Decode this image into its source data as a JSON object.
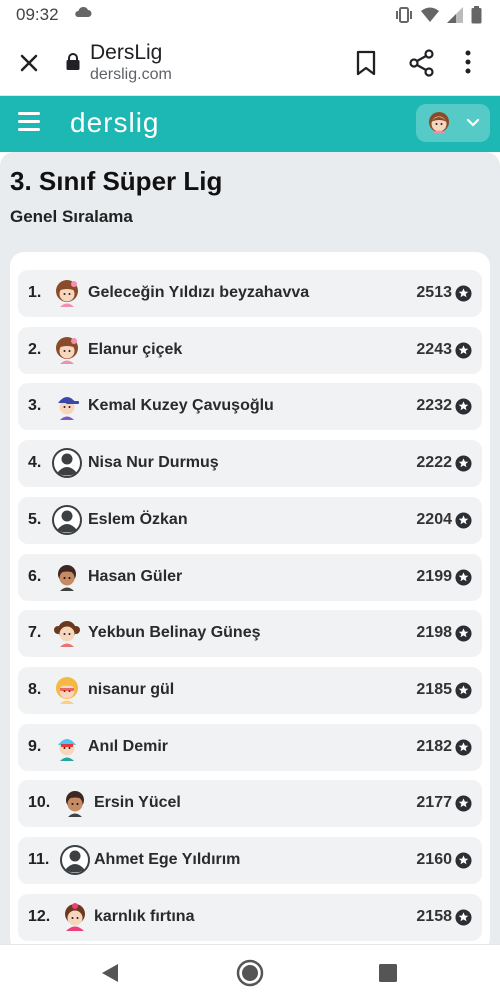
{
  "status_bar": {
    "time": "09:32"
  },
  "browser": {
    "title": "DersLig",
    "url": "derslig.com"
  },
  "app": {
    "logo": "derslig"
  },
  "page": {
    "title": "3. Sınıf Süper Lig",
    "subtitle": "Genel Sıralama"
  },
  "leaderboard": [
    {
      "rank": "1.",
      "name": "Geleceğin Yıldızı beyzahavva",
      "score": "2513",
      "avatar": "girl-avatar"
    },
    {
      "rank": "2.",
      "name": "Elanur çiçek",
      "score": "2243",
      "avatar": "girl-avatar"
    },
    {
      "rank": "3.",
      "name": "Kemal Kuzey Çavuşoğlu",
      "score": "2232",
      "avatar": "boy-cap-avatar"
    },
    {
      "rank": "4.",
      "name": "Nisa Nur Durmuş",
      "score": "2222",
      "avatar": "default-user-avatar"
    },
    {
      "rank": "5.",
      "name": "Eslem Özkan",
      "score": "2204",
      "avatar": "default-user-avatar"
    },
    {
      "rank": "6.",
      "name": "Hasan Güler",
      "score": "2199",
      "avatar": "boy-dark-avatar"
    },
    {
      "rank": "7.",
      "name": "Yekbun Belinay Güneş",
      "score": "2198",
      "avatar": "girl-pigtails-avatar"
    },
    {
      "rank": "8.",
      "name": "nisanur gül",
      "score": "2185",
      "avatar": "girl-blonde-avatar"
    },
    {
      "rank": "9.",
      "name": "Anıl Demir",
      "score": "2182",
      "avatar": "boy-helmet-avatar"
    },
    {
      "rank": "10.",
      "name": "Ersin Yücel",
      "score": "2177",
      "avatar": "boy-dark-avatar"
    },
    {
      "rank": "11.",
      "name": "Ahmet Ege Yıldırım",
      "score": "2160",
      "avatar": "default-user-avatar"
    },
    {
      "rank": "12.",
      "name": "karnlık fırtına",
      "score": "2158",
      "avatar": "girl-pink-avatar"
    }
  ],
  "colors": {
    "brand": "#1eb8b4",
    "page_bg": "#e9ecee",
    "row_bg": "#f1f2f3"
  }
}
